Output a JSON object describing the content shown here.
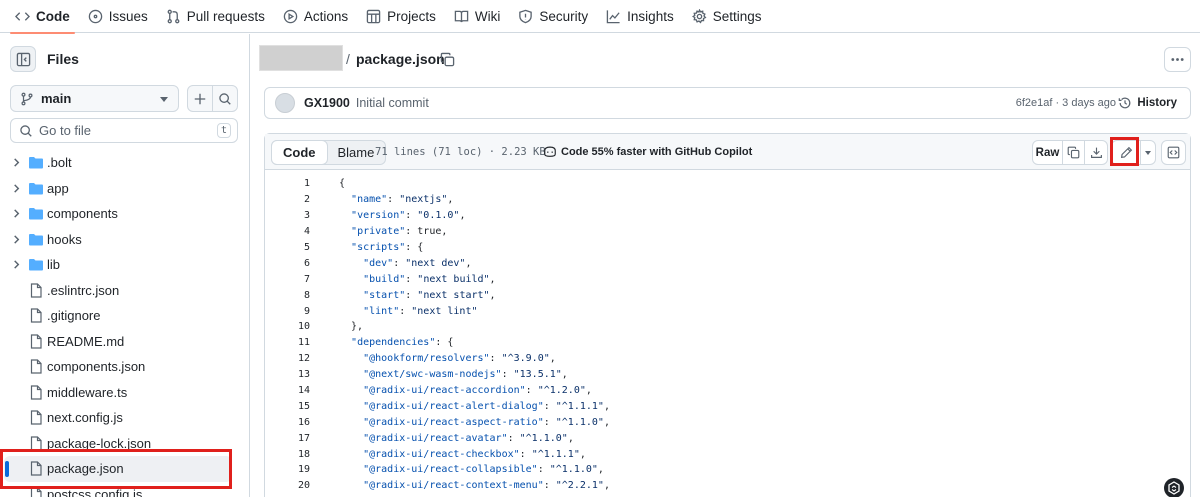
{
  "nav": [
    {
      "label": "Code",
      "icon": "code-icon",
      "active": true
    },
    {
      "label": "Issues",
      "icon": "issue-icon"
    },
    {
      "label": "Pull requests",
      "icon": "pull-request-icon"
    },
    {
      "label": "Actions",
      "icon": "play-icon"
    },
    {
      "label": "Projects",
      "icon": "table-icon"
    },
    {
      "label": "Wiki",
      "icon": "book-icon"
    },
    {
      "label": "Security",
      "icon": "shield-icon"
    },
    {
      "label": "Insights",
      "icon": "graph-icon"
    },
    {
      "label": "Settings",
      "icon": "gear-icon"
    }
  ],
  "sidebar": {
    "title": "Files",
    "branch": "main",
    "search_placeholder": "Go to file",
    "search_shortcut": "t",
    "items": [
      {
        "name": ".bolt",
        "type": "folder"
      },
      {
        "name": "app",
        "type": "folder"
      },
      {
        "name": "components",
        "type": "folder"
      },
      {
        "name": "hooks",
        "type": "folder"
      },
      {
        "name": "lib",
        "type": "folder"
      },
      {
        "name": ".eslintrc.json",
        "type": "file"
      },
      {
        "name": ".gitignore",
        "type": "file"
      },
      {
        "name": "README.md",
        "type": "file"
      },
      {
        "name": "components.json",
        "type": "file"
      },
      {
        "name": "middleware.ts",
        "type": "file"
      },
      {
        "name": "next.config.js",
        "type": "file"
      },
      {
        "name": "package-lock.json",
        "type": "file"
      },
      {
        "name": "package.json",
        "type": "file",
        "selected": true
      },
      {
        "name": "postcss.config.js",
        "type": "file"
      }
    ]
  },
  "breadcrumb": {
    "separator": "/",
    "file": "package.json"
  },
  "commit": {
    "author": "GX1900",
    "message": "Initial commit",
    "sha_time": "6f2e1af · 3 days ago",
    "history_label": "History"
  },
  "file_header": {
    "tab_code": "Code",
    "tab_blame": "Blame",
    "meta": "71 lines (71 loc) · 2.23 KB",
    "copilot": "Code 55% faster with GitHub Copilot",
    "raw_label": "Raw"
  },
  "code_lines": [
    {
      "n": "1",
      "t": "{"
    },
    {
      "n": "2",
      "t": "  \"name\": \"nextjs\","
    },
    {
      "n": "3",
      "t": "  \"version\": \"0.1.0\","
    },
    {
      "n": "4",
      "t": "  \"private\": true,"
    },
    {
      "n": "5",
      "t": "  \"scripts\": {"
    },
    {
      "n": "6",
      "t": "    \"dev\": \"next dev\","
    },
    {
      "n": "7",
      "t": "    \"build\": \"next build\","
    },
    {
      "n": "8",
      "t": "    \"start\": \"next start\","
    },
    {
      "n": "9",
      "t": "    \"lint\": \"next lint\""
    },
    {
      "n": "10",
      "t": "  },"
    },
    {
      "n": "11",
      "t": "  \"dependencies\": {"
    },
    {
      "n": "12",
      "t": "    \"@hookform/resolvers\": \"^3.9.0\","
    },
    {
      "n": "13",
      "t": "    \"@next/swc-wasm-nodejs\": \"13.5.1\","
    },
    {
      "n": "14",
      "t": "    \"@radix-ui/react-accordion\": \"^1.2.0\","
    },
    {
      "n": "15",
      "t": "    \"@radix-ui/react-alert-dialog\": \"^1.1.1\","
    },
    {
      "n": "16",
      "t": "    \"@radix-ui/react-aspect-ratio\": \"^1.1.0\","
    },
    {
      "n": "17",
      "t": "    \"@radix-ui/react-avatar\": \"^1.1.0\","
    },
    {
      "n": "18",
      "t": "    \"@radix-ui/react-checkbox\": \"^1.1.1\","
    },
    {
      "n": "19",
      "t": "    \"@radix-ui/react-collapsible\": \"^1.1.0\","
    },
    {
      "n": "20",
      "t": "    \"@radix-ui/react-context-menu\": \"^2.2.1\","
    }
  ],
  "colors": {
    "accent": "#fd8c73",
    "folder": "#54aeff",
    "highlight": "#e0201c",
    "selected_bar": "#0969da"
  }
}
